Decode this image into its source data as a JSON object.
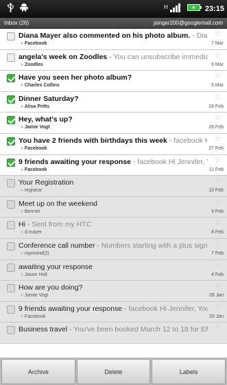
{
  "status_bar": {
    "time": "23:15",
    "icons": [
      "usb-icon",
      "android-icon",
      "signal-icon",
      "battery-icon"
    ]
  },
  "header": {
    "folder": "Inbox (26)",
    "account": "jsinger200@googlemail.com"
  },
  "messages": [
    {
      "subject": "Diana Mayer also commented on his photo album.",
      "snippet": " - Diana ...",
      "sender": "Facebook",
      "date": "7 Mar",
      "read": false,
      "checked": false
    },
    {
      "subject": "angela's week on Zoodles",
      "snippet": " - You can unsubscribe immediatel...",
      "sender": "Zoodles",
      "date": "6 Mar",
      "read": false,
      "checked": false
    },
    {
      "subject": "Have you seen her photo album?",
      "snippet": "",
      "sender": "Charles Collins",
      "date": "5 Mar",
      "read": false,
      "checked": true
    },
    {
      "subject": "Dinner Saturday?",
      "snippet": "",
      "sender": "Alisa Pritts",
      "date": "28 Feb",
      "read": false,
      "checked": true
    },
    {
      "subject": "Hey, what's up?",
      "snippet": "",
      "sender": "Jamie Vogt",
      "date": "28 Feb",
      "read": false,
      "checked": true
    },
    {
      "subject": "You have 2 friends with birthdays this week",
      "snippet": " - facebook Hi Je...",
      "sender": "Facebook",
      "date": "27 Feb",
      "read": false,
      "checked": true
    },
    {
      "subject": "9 friends awaiting your response",
      "snippet": " - facebook Hi Jennifer, You...",
      "sender": "Facebook",
      "date": "11 Feb",
      "read": false,
      "checked": true
    },
    {
      "subject": "Your Registration",
      "snippet": "",
      "sender": "registrar",
      "date": "10 Feb",
      "read": true,
      "checked": false
    },
    {
      "subject": "Meet up on the weekend",
      "snippet": "",
      "sender": "Bennet",
      "date": "9 Feb",
      "read": true,
      "checked": false
    },
    {
      "subject": "Hi",
      "snippet": " - Sent from my HTC",
      "sender": "d.mayer",
      "date": "8 Feb",
      "read": true,
      "checked": false
    },
    {
      "subject": "Conference call number",
      "snippet": " - Numbers starting with a plus sign (+). ...",
      "sender": "raymond(2)",
      "date": "7 Feb",
      "read": true,
      "checked": false
    },
    {
      "subject": "awaiting your response",
      "snippet": "",
      "sender": "Jason Holt",
      "date": "4 Feb",
      "read": true,
      "checked": false
    },
    {
      "subject": "How are you doing?",
      "snippet": "",
      "sender": "Jamie Vogt",
      "date": "28 Jan",
      "read": true,
      "checked": false
    },
    {
      "subject": "9 friends awaiting your response",
      "snippet": " - facebook Hi Jennifer, You hav...",
      "sender": "Facebook",
      "date": "20 Jan",
      "read": true,
      "checked": false
    },
    {
      "subject": "Business travel",
      "snippet": " - You've been booked March 12 to 18 for EMEA ...",
      "sender": "",
      "date": "",
      "read": true,
      "checked": false
    }
  ],
  "toolbar": {
    "archive_label": "Archive",
    "delete_label": "Delete",
    "labels_label": "Labels"
  },
  "colors": {
    "checked_green": "#3eb33e",
    "read_row_bg": "#e4e4e4",
    "status_bar_bg": "#0d0d0d"
  }
}
